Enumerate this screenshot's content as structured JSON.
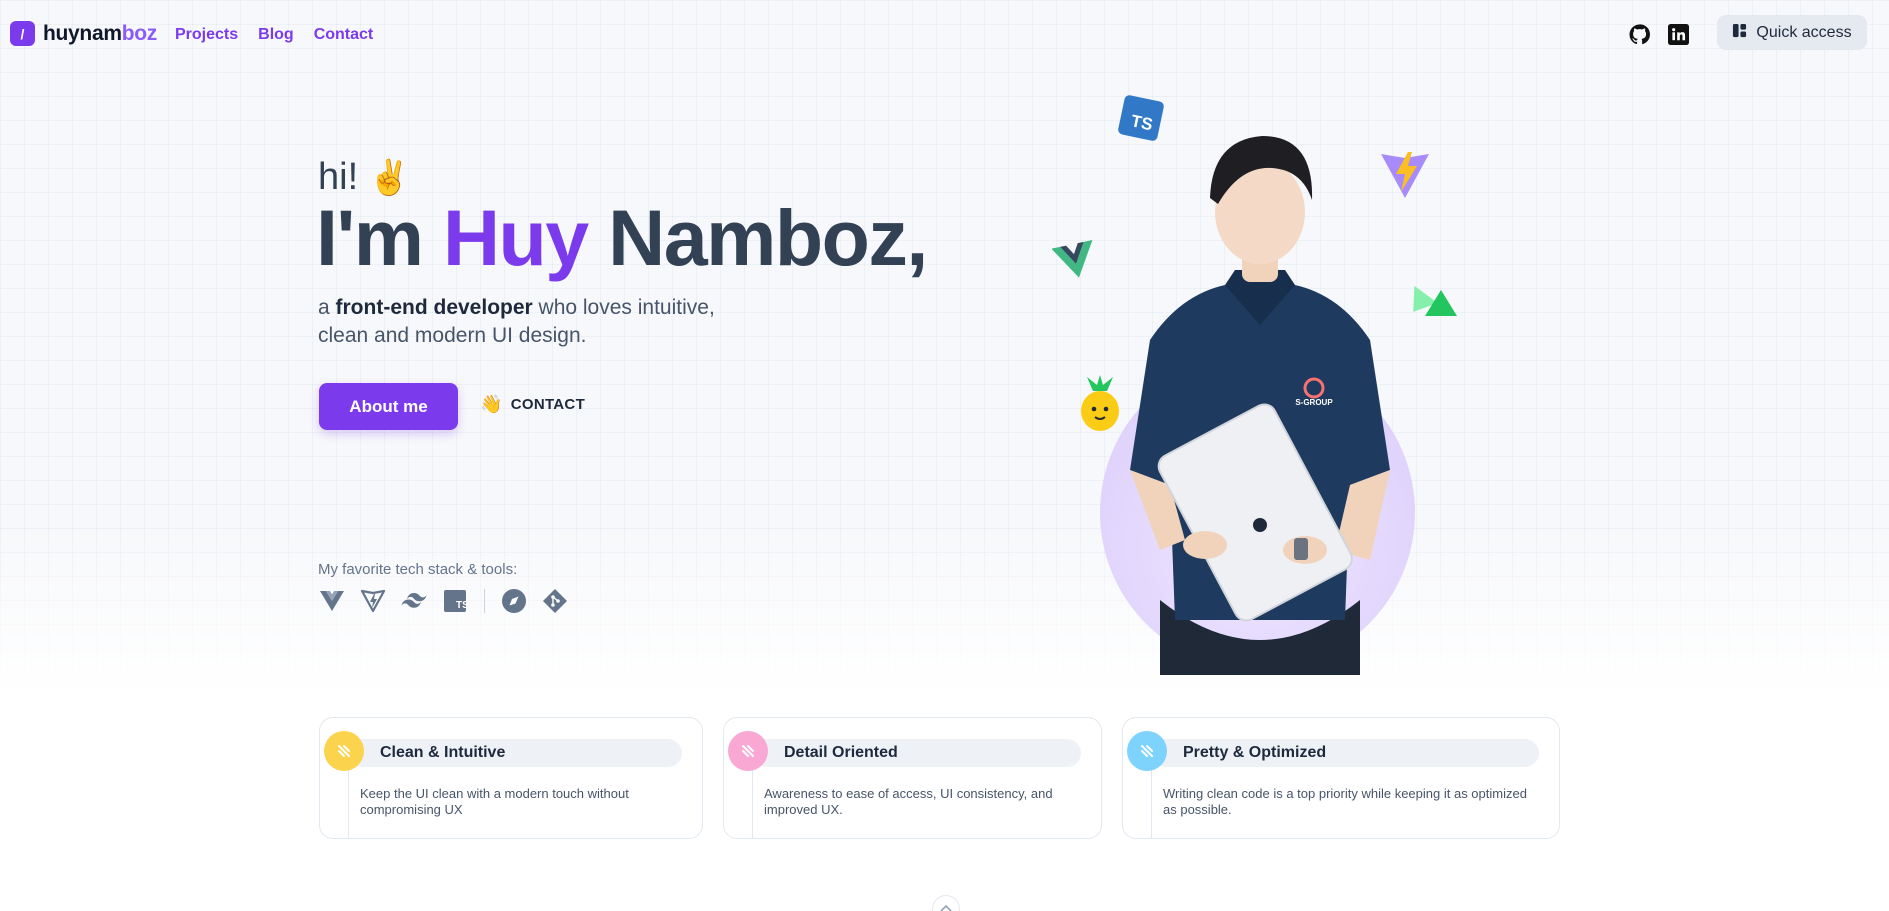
{
  "header": {
    "logo_mark": "/",
    "logo_prefix": "huynam",
    "logo_suffix": "boz",
    "nav": [
      "Projects",
      "Blog",
      "Contact"
    ],
    "social_icons": [
      "github-icon",
      "linkedin-icon"
    ],
    "quick_access_label": "Quick access"
  },
  "hero": {
    "greeting": "hi!",
    "greeting_emoji": "✌️",
    "headline_prefix": "I'm ",
    "headline_name": "Huy",
    "headline_suffix": " Namboz,",
    "sub_prefix": "a ",
    "sub_bold": "front-end developer",
    "sub_rest": " who loves intuitive, clean and modern UI design.",
    "about_button": "About me",
    "contact_emoji": "👋",
    "contact_button": "CONTACT",
    "stack_label": "My favorite tech stack & tools:",
    "stack_icons": [
      "vue-icon",
      "vite-icon",
      "tailwind-icon",
      "typescript-icon",
      "compass-icon",
      "git-icon"
    ],
    "shirt_label": "S-GROUP"
  },
  "floating_icons": [
    "typescript-badge",
    "vite-logo",
    "vue-logo",
    "nuxt-logo",
    "pineapple-emoji"
  ],
  "features": [
    {
      "title": "Clean & Intuitive",
      "desc": "Keep the UI clean with a modern touch without compromising UX",
      "color": "#fcd34d"
    },
    {
      "title": "Detail Oriented",
      "desc": "Awareness to ease of access, UI consistency, and improved UX.",
      "color": "#f9a8d4"
    },
    {
      "title": "Pretty & Optimized",
      "desc": "Writing clean code is a top priority while keeping it as optimized as possible.",
      "color": "#7dd3fc"
    }
  ],
  "colors": {
    "accent": "#7c3aed",
    "text": "#334155"
  }
}
